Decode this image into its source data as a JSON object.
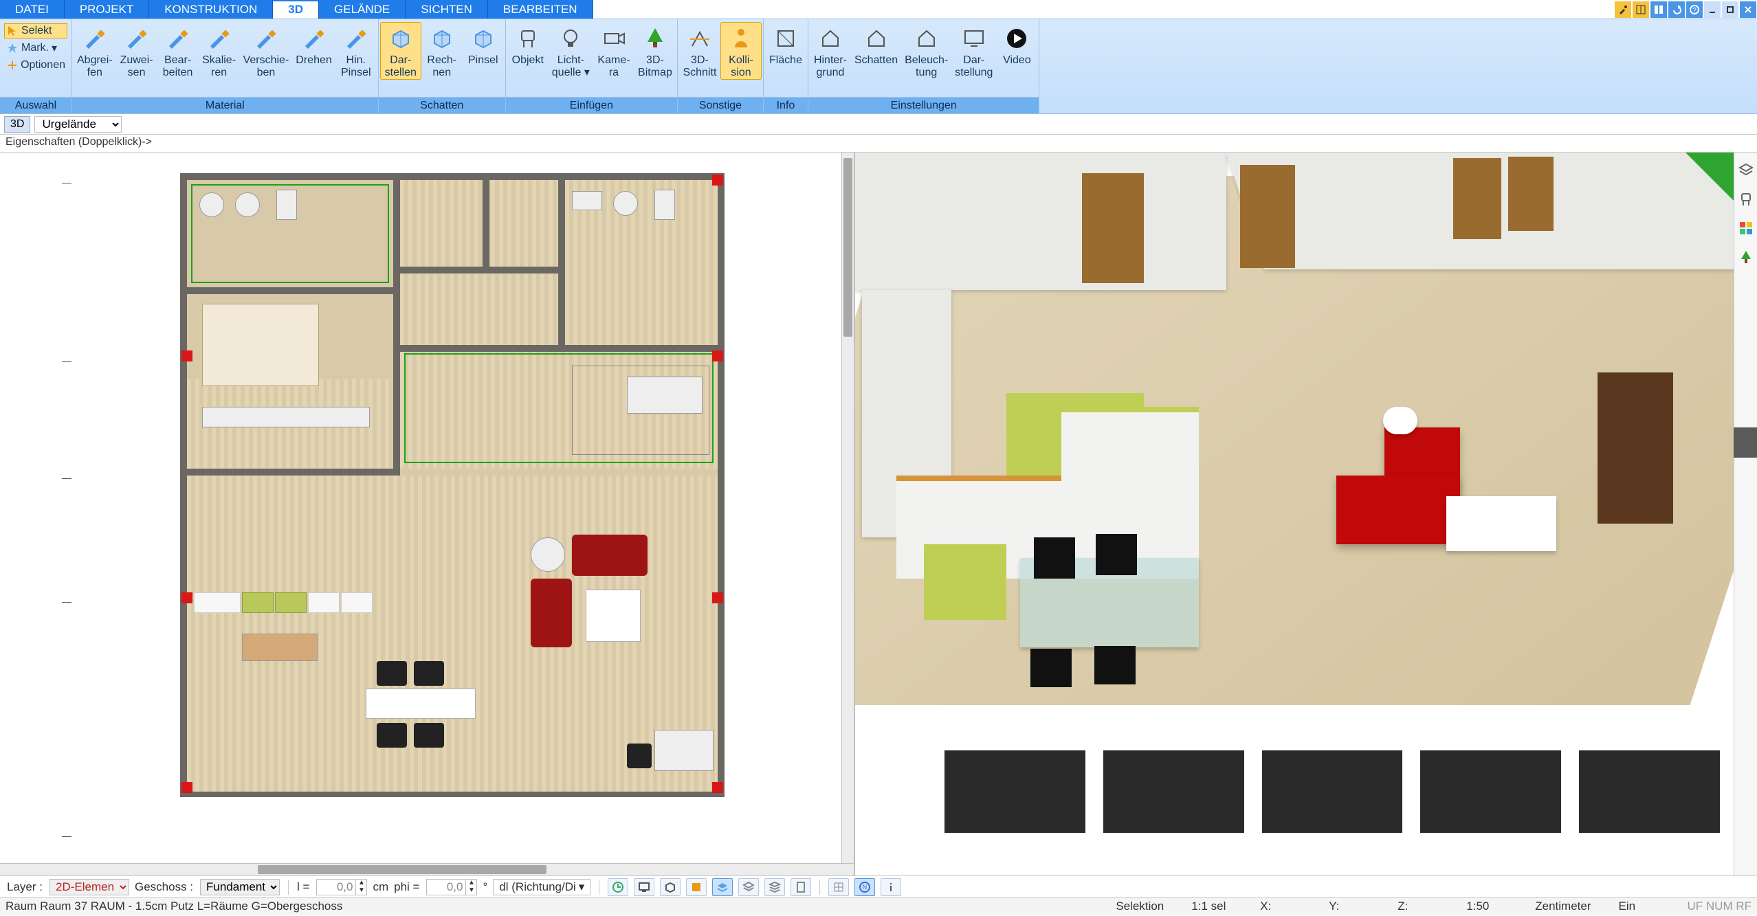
{
  "menu": {
    "tabs": [
      "DATEI",
      "PROJEKT",
      "KONSTRUKTION",
      "3D",
      "GELÄNDE",
      "SICHTEN",
      "BEARBEITEN"
    ],
    "active_index": 3
  },
  "ribbon": {
    "panels": [
      {
        "id": "auswahl",
        "caption": "Auswahl",
        "select_buttons": [
          {
            "icon": "cursor",
            "label": "Selekt",
            "active": true
          },
          {
            "icon": "star",
            "label": "Mark.",
            "dropdown": true
          },
          {
            "icon": "plus",
            "label": "Optionen"
          }
        ]
      },
      {
        "id": "material",
        "caption": "Material",
        "buttons": [
          {
            "icon": "brush-minus",
            "label": "Abgrei-\nfen"
          },
          {
            "icon": "brush-plus",
            "label": "Zuwei-\nsen"
          },
          {
            "icon": "brush-edit",
            "label": "Bear-\nbeiten"
          },
          {
            "icon": "brush-scale",
            "label": "Skalie-\nren"
          },
          {
            "icon": "brush-move",
            "label": "Verschie-\nben"
          },
          {
            "icon": "brush-rotate",
            "label": "Drehen"
          },
          {
            "icon": "brush-back",
            "label": "Hin.\nPinsel"
          }
        ]
      },
      {
        "id": "schatten",
        "caption": "Schatten",
        "buttons": [
          {
            "icon": "cube-shade",
            "label": "Dar-\nstellen",
            "active": true
          },
          {
            "icon": "cube-calc",
            "label": "Rech-\nnen"
          },
          {
            "icon": "cube-brush",
            "label": "Pinsel"
          }
        ]
      },
      {
        "id": "einfuegen",
        "caption": "Einfügen",
        "buttons": [
          {
            "icon": "chair",
            "label": "Objekt"
          },
          {
            "icon": "bulb",
            "label": "Licht-\nquelle",
            "dropdown": true
          },
          {
            "icon": "camera",
            "label": "Kame-\nra"
          },
          {
            "icon": "tree",
            "label": "3D-\nBitmap"
          }
        ]
      },
      {
        "id": "sonstige",
        "caption": "Sonstige",
        "buttons": [
          {
            "icon": "section",
            "label": "3D-\nSchnitt"
          },
          {
            "icon": "person",
            "label": "Kolli-\nsion",
            "active": true
          }
        ]
      },
      {
        "id": "info",
        "caption": "Info",
        "buttons": [
          {
            "icon": "area",
            "label": "Fläche"
          }
        ]
      },
      {
        "id": "einstellungen",
        "caption": "Einstellungen",
        "buttons": [
          {
            "icon": "house-bg",
            "label": "Hinter-\ngrund"
          },
          {
            "icon": "house-shade",
            "label": "Schatten"
          },
          {
            "icon": "house-light",
            "label": "Beleuch-\ntung"
          },
          {
            "icon": "monitor",
            "label": "Dar-\nstellung"
          },
          {
            "icon": "play",
            "label": "Video"
          }
        ]
      }
    ]
  },
  "context": {
    "mode_badge": "3D",
    "terrain_select": "Urgelände",
    "hint": "Eigenschaften (Doppelklick)->"
  },
  "bottombar": {
    "layer_label": "Layer :",
    "layer_value": "2D-Elemen",
    "geschoss_label": "Geschoss :",
    "geschoss_value": "Fundament",
    "l_label": "l =",
    "l_value": "0,0",
    "l_unit": "cm",
    "phi_label": "phi =",
    "phi_value": "0,0",
    "phi_unit": "°",
    "dl_value": "dl (Richtung/Di"
  },
  "status": {
    "text": "Raum Raum 37 RAUM - 1.5cm Putz L=Räume G=Obergeschoss",
    "selektion": "Selektion",
    "sel_info": "1:1 sel",
    "x": "X:",
    "y": "Y:",
    "z": "Z:",
    "scale": "1:50",
    "unit": "Zentimeter",
    "on": "Ein",
    "flags": "UF NUM RF"
  },
  "palette": {
    "items": [
      "layers",
      "chair",
      "swatches",
      "tree"
    ]
  }
}
